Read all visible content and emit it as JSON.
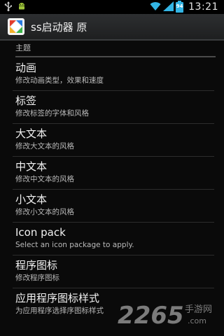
{
  "status_bar": {
    "icons": [
      "usb-icon",
      "android-icon",
      "wifi-icon",
      "signal-icon",
      "battery-icon"
    ],
    "battery_level": "94",
    "clock": "13:21"
  },
  "action_bar": {
    "title": "ss启动器 原"
  },
  "section": {
    "header": "主题"
  },
  "preferences": [
    {
      "title": "动画",
      "summary": "修改动画类型，效果和速度"
    },
    {
      "title": "标签",
      "summary": "修改标签的字体和风格"
    },
    {
      "title": "大文本",
      "summary": "修改大文本的风格"
    },
    {
      "title": "中文本",
      "summary": "修改中文本的风格"
    },
    {
      "title": "小文本",
      "summary": "修改小文本的风格"
    },
    {
      "title": "Icon pack",
      "summary": "Select an icon package to apply."
    },
    {
      "title": "程序图标",
      "summary": "修改程序图标"
    },
    {
      "title": "应用程序图标样式",
      "summary": "为应用程序选择序图标样式"
    }
  ],
  "watermark": {
    "number": "2265",
    "site": "手游网",
    "domain": ".com"
  },
  "colors": {
    "accent": "#33b5e5",
    "background": "#0a0a0a"
  }
}
